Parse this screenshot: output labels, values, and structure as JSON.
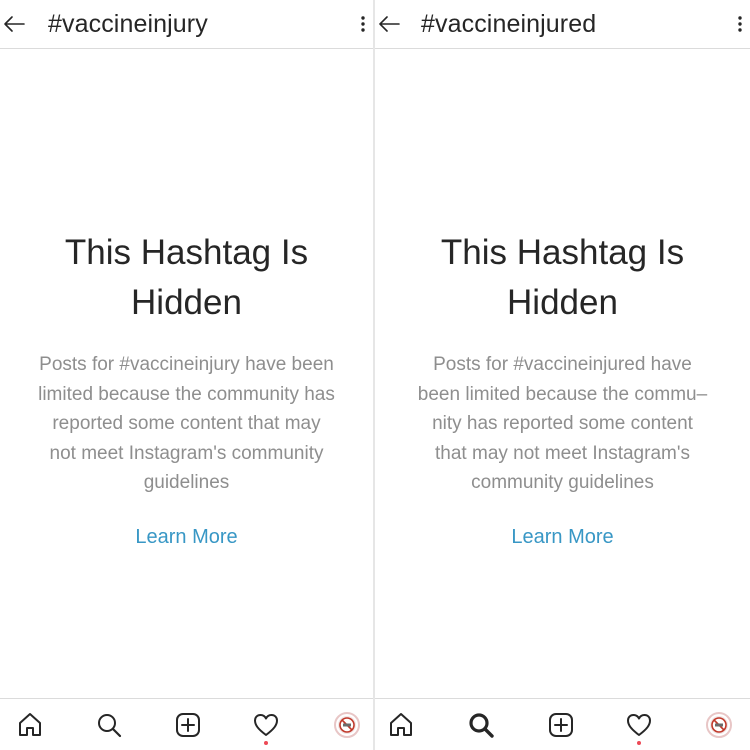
{
  "screens": [
    {
      "hashtag": "#vaccineinjury",
      "heading_line1": "This Hashtag Is",
      "heading_line2": "Hidden",
      "body_lines": [
        "Posts for #vaccineinjury have been",
        "limited because the community has",
        "reported some content that may",
        "not meet Instagram's community",
        "guidelines"
      ],
      "link_label": "Learn More",
      "nav_icons": [
        "home-icon",
        "search-icon",
        "new-post-icon",
        "activity-heart-icon",
        "profile-avatar"
      ],
      "active_nav": "none"
    },
    {
      "hashtag": "#vaccineinjured",
      "heading_line1": "This Hashtag Is",
      "heading_line2": "Hidden",
      "body_lines": [
        "Posts for #vaccineinjured have",
        "been limited because the commu–",
        "nity has reported some content",
        "that may not meet Instagram's",
        "community guidelines"
      ],
      "link_label": "Learn More",
      "nav_icons": [
        "home-icon",
        "search-icon",
        "new-post-icon",
        "activity-heart-icon",
        "profile-avatar"
      ],
      "active_nav": "search"
    }
  ],
  "colors": {
    "text": "#262626",
    "muted": "#8e8e8e",
    "link": "#3897c5",
    "notification_dot": "#ed4956",
    "border": "#dbdbdb"
  }
}
